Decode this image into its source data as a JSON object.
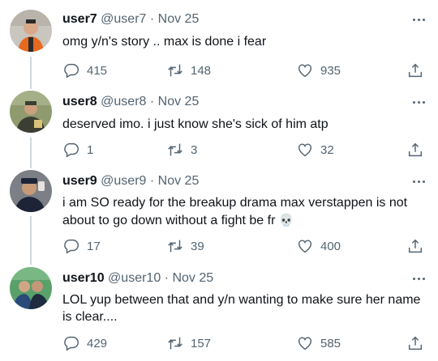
{
  "tweets": [
    {
      "name": "user7",
      "handle": "@user7",
      "date": "Nov 25",
      "text": "omg y/n's story .. max is done i fear",
      "replies": "415",
      "retweets": "148",
      "likes": "935",
      "avatar_bg": "#c9c6c0",
      "avatar_accent": "#e56a1d"
    },
    {
      "name": "user8",
      "handle": "@user8",
      "date": "Nov 25",
      "text": "deserved imo. i just know she's sick of him atp",
      "replies": "1",
      "retweets": "3",
      "likes": "32",
      "avatar_bg": "#8f9a6e",
      "avatar_accent": "#3b3f33"
    },
    {
      "name": "user9",
      "handle": "@user9",
      "date": "Nov 25",
      "text": "i am SO ready for the breakup drama max verstappen is not about to go down without a fight be fr",
      "emoji": "💀",
      "replies": "17",
      "retweets": "39",
      "likes": "400",
      "avatar_bg": "#7d7f86",
      "avatar_accent": "#1d2437"
    },
    {
      "name": "user10",
      "handle": "@user10",
      "date": "Nov 25",
      "text": "LOL yup between that and y/n wanting to make sure her name is clear....",
      "replies": "429",
      "retweets": "157",
      "likes": "585",
      "avatar_bg": "#5aa06a",
      "avatar_accent": "#2a4a7a"
    }
  ],
  "separator": "·",
  "colors": {
    "text": "#0f1419",
    "secondary": "#536471",
    "thread_line": "#cfd9de"
  },
  "icons": [
    "reply-icon",
    "retweet-icon",
    "like-icon",
    "share-icon",
    "more-icon"
  ]
}
